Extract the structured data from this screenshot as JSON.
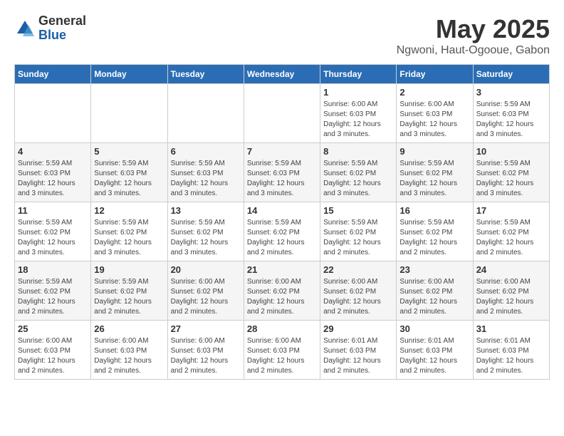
{
  "logo": {
    "general": "General",
    "blue": "Blue"
  },
  "header": {
    "title": "May 2025",
    "subtitle": "Ngwoni, Haut-Ogooue, Gabon"
  },
  "weekdays": [
    "Sunday",
    "Monday",
    "Tuesday",
    "Wednesday",
    "Thursday",
    "Friday",
    "Saturday"
  ],
  "weeks": [
    [
      {
        "day": "",
        "info": ""
      },
      {
        "day": "",
        "info": ""
      },
      {
        "day": "",
        "info": ""
      },
      {
        "day": "",
        "info": ""
      },
      {
        "day": "1",
        "info": "Sunrise: 6:00 AM\nSunset: 6:03 PM\nDaylight: 12 hours\nand 3 minutes."
      },
      {
        "day": "2",
        "info": "Sunrise: 6:00 AM\nSunset: 6:03 PM\nDaylight: 12 hours\nand 3 minutes."
      },
      {
        "day": "3",
        "info": "Sunrise: 5:59 AM\nSunset: 6:03 PM\nDaylight: 12 hours\nand 3 minutes."
      }
    ],
    [
      {
        "day": "4",
        "info": "Sunrise: 5:59 AM\nSunset: 6:03 PM\nDaylight: 12 hours\nand 3 minutes."
      },
      {
        "day": "5",
        "info": "Sunrise: 5:59 AM\nSunset: 6:03 PM\nDaylight: 12 hours\nand 3 minutes."
      },
      {
        "day": "6",
        "info": "Sunrise: 5:59 AM\nSunset: 6:03 PM\nDaylight: 12 hours\nand 3 minutes."
      },
      {
        "day": "7",
        "info": "Sunrise: 5:59 AM\nSunset: 6:03 PM\nDaylight: 12 hours\nand 3 minutes."
      },
      {
        "day": "8",
        "info": "Sunrise: 5:59 AM\nSunset: 6:02 PM\nDaylight: 12 hours\nand 3 minutes."
      },
      {
        "day": "9",
        "info": "Sunrise: 5:59 AM\nSunset: 6:02 PM\nDaylight: 12 hours\nand 3 minutes."
      },
      {
        "day": "10",
        "info": "Sunrise: 5:59 AM\nSunset: 6:02 PM\nDaylight: 12 hours\nand 3 minutes."
      }
    ],
    [
      {
        "day": "11",
        "info": "Sunrise: 5:59 AM\nSunset: 6:02 PM\nDaylight: 12 hours\nand 3 minutes."
      },
      {
        "day": "12",
        "info": "Sunrise: 5:59 AM\nSunset: 6:02 PM\nDaylight: 12 hours\nand 3 minutes."
      },
      {
        "day": "13",
        "info": "Sunrise: 5:59 AM\nSunset: 6:02 PM\nDaylight: 12 hours\nand 3 minutes."
      },
      {
        "day": "14",
        "info": "Sunrise: 5:59 AM\nSunset: 6:02 PM\nDaylight: 12 hours\nand 2 minutes."
      },
      {
        "day": "15",
        "info": "Sunrise: 5:59 AM\nSunset: 6:02 PM\nDaylight: 12 hours\nand 2 minutes."
      },
      {
        "day": "16",
        "info": "Sunrise: 5:59 AM\nSunset: 6:02 PM\nDaylight: 12 hours\nand 2 minutes."
      },
      {
        "day": "17",
        "info": "Sunrise: 5:59 AM\nSunset: 6:02 PM\nDaylight: 12 hours\nand 2 minutes."
      }
    ],
    [
      {
        "day": "18",
        "info": "Sunrise: 5:59 AM\nSunset: 6:02 PM\nDaylight: 12 hours\nand 2 minutes."
      },
      {
        "day": "19",
        "info": "Sunrise: 5:59 AM\nSunset: 6:02 PM\nDaylight: 12 hours\nand 2 minutes."
      },
      {
        "day": "20",
        "info": "Sunrise: 6:00 AM\nSunset: 6:02 PM\nDaylight: 12 hours\nand 2 minutes."
      },
      {
        "day": "21",
        "info": "Sunrise: 6:00 AM\nSunset: 6:02 PM\nDaylight: 12 hours\nand 2 minutes."
      },
      {
        "day": "22",
        "info": "Sunrise: 6:00 AM\nSunset: 6:02 PM\nDaylight: 12 hours\nand 2 minutes."
      },
      {
        "day": "23",
        "info": "Sunrise: 6:00 AM\nSunset: 6:02 PM\nDaylight: 12 hours\nand 2 minutes."
      },
      {
        "day": "24",
        "info": "Sunrise: 6:00 AM\nSunset: 6:02 PM\nDaylight: 12 hours\nand 2 minutes."
      }
    ],
    [
      {
        "day": "25",
        "info": "Sunrise: 6:00 AM\nSunset: 6:03 PM\nDaylight: 12 hours\nand 2 minutes."
      },
      {
        "day": "26",
        "info": "Sunrise: 6:00 AM\nSunset: 6:03 PM\nDaylight: 12 hours\nand 2 minutes."
      },
      {
        "day": "27",
        "info": "Sunrise: 6:00 AM\nSunset: 6:03 PM\nDaylight: 12 hours\nand 2 minutes."
      },
      {
        "day": "28",
        "info": "Sunrise: 6:00 AM\nSunset: 6:03 PM\nDaylight: 12 hours\nand 2 minutes."
      },
      {
        "day": "29",
        "info": "Sunrise: 6:01 AM\nSunset: 6:03 PM\nDaylight: 12 hours\nand 2 minutes."
      },
      {
        "day": "30",
        "info": "Sunrise: 6:01 AM\nSunset: 6:03 PM\nDaylight: 12 hours\nand 2 minutes."
      },
      {
        "day": "31",
        "info": "Sunrise: 6:01 AM\nSunset: 6:03 PM\nDaylight: 12 hours\nand 2 minutes."
      }
    ]
  ]
}
